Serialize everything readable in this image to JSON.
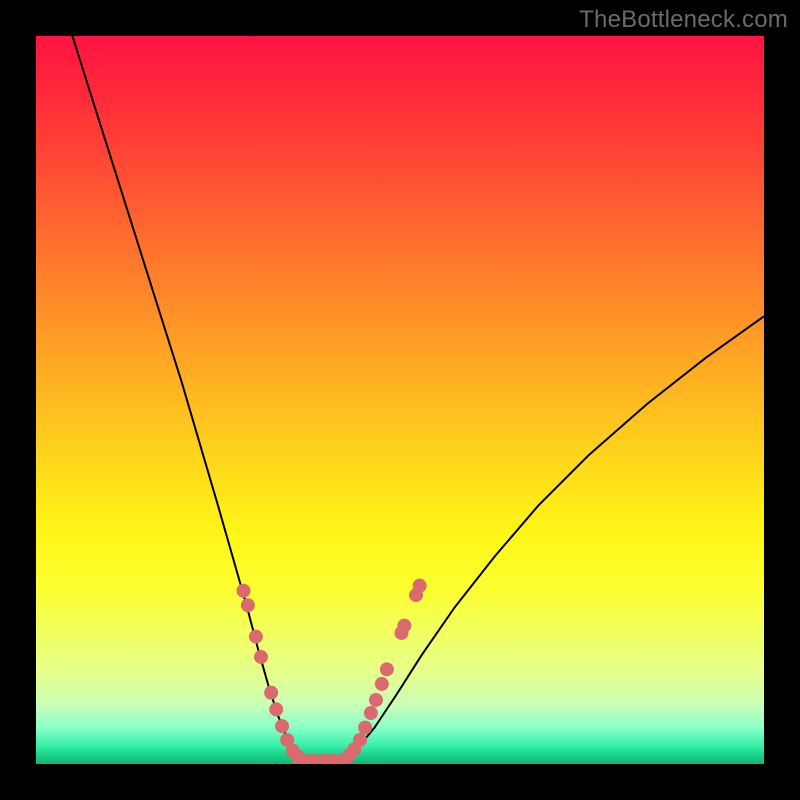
{
  "watermark": "TheBottleneck.com",
  "chart_data": {
    "type": "line",
    "title": "",
    "xlabel": "",
    "ylabel": "",
    "xlim": [
      0,
      1
    ],
    "ylim": [
      0,
      1
    ],
    "series": [
      {
        "name": "left-curve",
        "x": [
          0.05,
          0.08,
          0.11,
          0.14,
          0.17,
          0.2,
          0.225,
          0.25,
          0.27,
          0.29,
          0.305,
          0.32,
          0.333,
          0.345,
          0.357,
          0.367
        ],
        "y": [
          1.0,
          0.905,
          0.81,
          0.715,
          0.62,
          0.525,
          0.44,
          0.355,
          0.285,
          0.215,
          0.158,
          0.105,
          0.065,
          0.035,
          0.015,
          0.005
        ]
      },
      {
        "name": "right-curve",
        "x": [
          0.42,
          0.44,
          0.465,
          0.495,
          0.53,
          0.575,
          0.63,
          0.69,
          0.76,
          0.84,
          0.92,
          1.0
        ],
        "y": [
          0.005,
          0.02,
          0.05,
          0.095,
          0.15,
          0.215,
          0.285,
          0.355,
          0.425,
          0.495,
          0.558,
          0.615
        ]
      }
    ],
    "markers_left": [
      [
        0.285,
        0.238
      ],
      [
        0.291,
        0.218
      ],
      [
        0.302,
        0.175
      ],
      [
        0.309,
        0.147
      ],
      [
        0.323,
        0.098
      ],
      [
        0.33,
        0.075
      ],
      [
        0.338,
        0.052
      ],
      [
        0.345,
        0.033
      ],
      [
        0.353,
        0.018
      ],
      [
        0.36,
        0.01
      ]
    ],
    "markers_right": [
      [
        0.43,
        0.012
      ],
      [
        0.437,
        0.02
      ],
      [
        0.445,
        0.033
      ],
      [
        0.452,
        0.05
      ],
      [
        0.46,
        0.07
      ],
      [
        0.467,
        0.088
      ],
      [
        0.475,
        0.11
      ],
      [
        0.482,
        0.13
      ],
      [
        0.502,
        0.18
      ],
      [
        0.506,
        0.19
      ],
      [
        0.522,
        0.232
      ],
      [
        0.527,
        0.245
      ]
    ],
    "markers_bottom": [
      [
        0.367,
        0.0045
      ],
      [
        0.38,
        0.0045
      ],
      [
        0.395,
        0.0045
      ],
      [
        0.408,
        0.0045
      ],
      [
        0.42,
        0.0045
      ]
    ],
    "bottom_segment": {
      "x0": 0.36,
      "x1": 0.425,
      "y": 0.0045
    },
    "marker_color": "#db6a6e"
  }
}
